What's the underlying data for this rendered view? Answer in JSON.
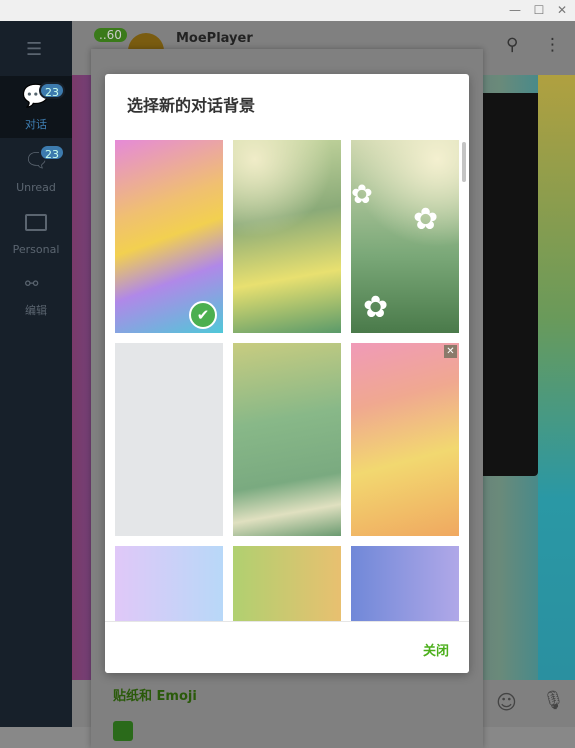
{
  "window": {
    "controls": [
      "minimize",
      "maximize",
      "close"
    ]
  },
  "sidebar": {
    "items": [
      {
        "label": "对话",
        "badge": "23",
        "icon": "chats-icon",
        "active": true
      },
      {
        "label": "Unread",
        "badge": "23",
        "icon": "chat-bubble-icon"
      },
      {
        "label": "Personal",
        "icon": "folder-icon"
      },
      {
        "label": "编辑",
        "icon": "sliders-icon"
      }
    ]
  },
  "chat": {
    "back_badge": "..60",
    "name": "MoePlayer",
    "avatar_color": "#d99a00"
  },
  "composer": {
    "section_label": "贴纸和 Emoji"
  },
  "modal": {
    "title": "选择新的对话背景",
    "close_label": "关闭",
    "accent": "#4caf1c",
    "backgrounds": [
      {
        "name": "zoo-gradient",
        "selected": true
      },
      {
        "name": "green-blur"
      },
      {
        "name": "daisies"
      },
      {
        "name": "light-gray-pattern"
      },
      {
        "name": "green-pattern"
      },
      {
        "name": "pink-yellow-pattern",
        "deletable": true
      },
      {
        "name": "lavender-pattern"
      },
      {
        "name": "green-orange-pattern"
      },
      {
        "name": "blue-purple-pattern"
      }
    ]
  }
}
